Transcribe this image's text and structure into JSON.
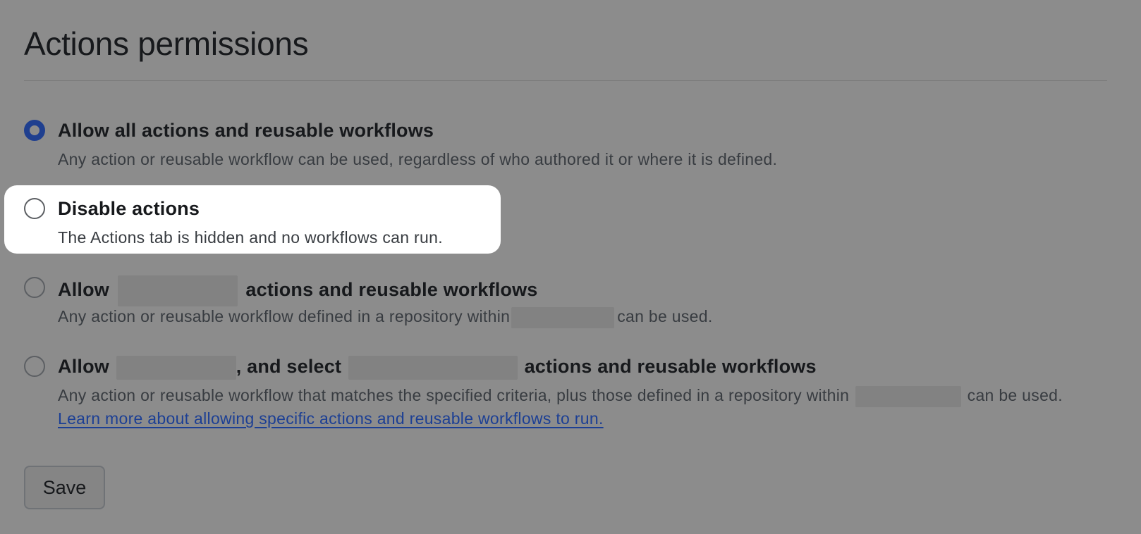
{
  "page": {
    "title": "Actions permissions"
  },
  "options": [
    {
      "label": "Allow all actions and reusable workflows",
      "description": "Any action or reusable workflow can be used, regardless of who authored it or where it is defined.",
      "checked": true
    },
    {
      "label": "Disable actions",
      "description": "The Actions tab is hidden and no workflows can run.",
      "checked": false,
      "highlighted": true
    },
    {
      "label_before": "Allow",
      "label_after": "actions and reusable workflows",
      "description_before": "Any action or reusable workflow defined in a repository within",
      "description_after": "can be used.",
      "checked": false
    },
    {
      "label_before": "Allow",
      "label_middle": ", and select",
      "label_after": "actions and reusable workflows",
      "description_before": "Any action or reusable workflow that matches the specified criteria, plus those defined in a repository within",
      "description_after": "can be used.",
      "link_text": "Learn more about allowing specific actions and reusable workflows to run.",
      "checked": false
    }
  ],
  "actions": {
    "save_label": "Save"
  },
  "colors": {
    "overlay_background": "#8c8c8c",
    "radio_checked": "#1f3f8f",
    "link": "#1c3f94",
    "highlight": "#ffffff"
  }
}
